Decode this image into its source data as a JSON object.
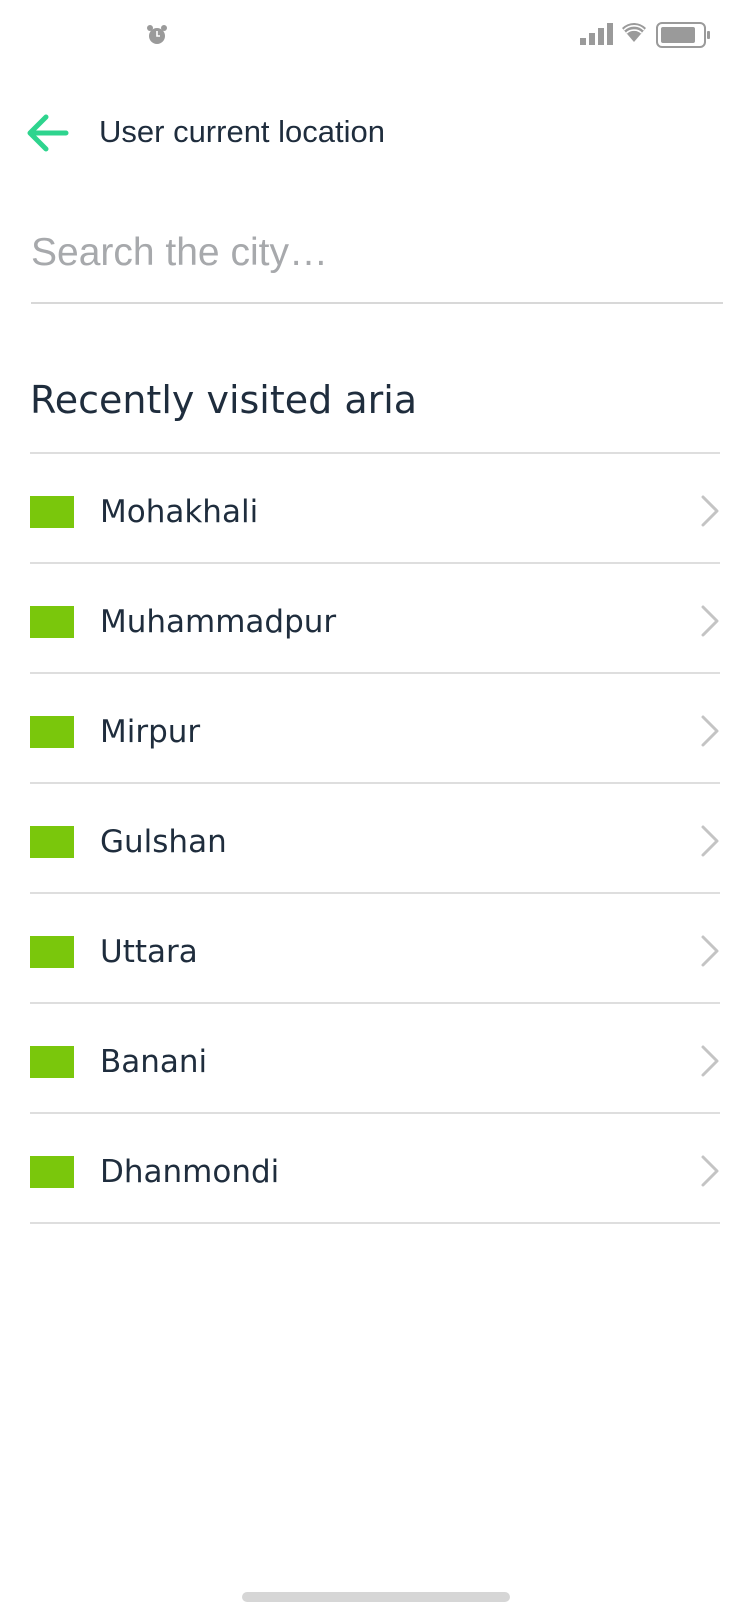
{
  "status_bar": {
    "icons": [
      "alarm-icon",
      "signal-icon",
      "wifi-icon",
      "battery-icon"
    ]
  },
  "header": {
    "back_icon": "arrow-left-icon",
    "title": "User current location"
  },
  "search": {
    "placeholder": "Search the city…",
    "value": ""
  },
  "recent": {
    "title": "Recently visited aria",
    "items": [
      {
        "label": "Mohakhali"
      },
      {
        "label": "Muhammadpur"
      },
      {
        "label": "Mirpur"
      },
      {
        "label": "Gulshan"
      },
      {
        "label": "Uttara"
      },
      {
        "label": "Banani"
      },
      {
        "label": "Dhanmondi"
      }
    ]
  },
  "colors": {
    "accent": "#2ed48e",
    "swatch": "#7ac70c",
    "text": "#1f2d3d",
    "divider": "#dedede",
    "placeholder": "#a7a9ac"
  }
}
